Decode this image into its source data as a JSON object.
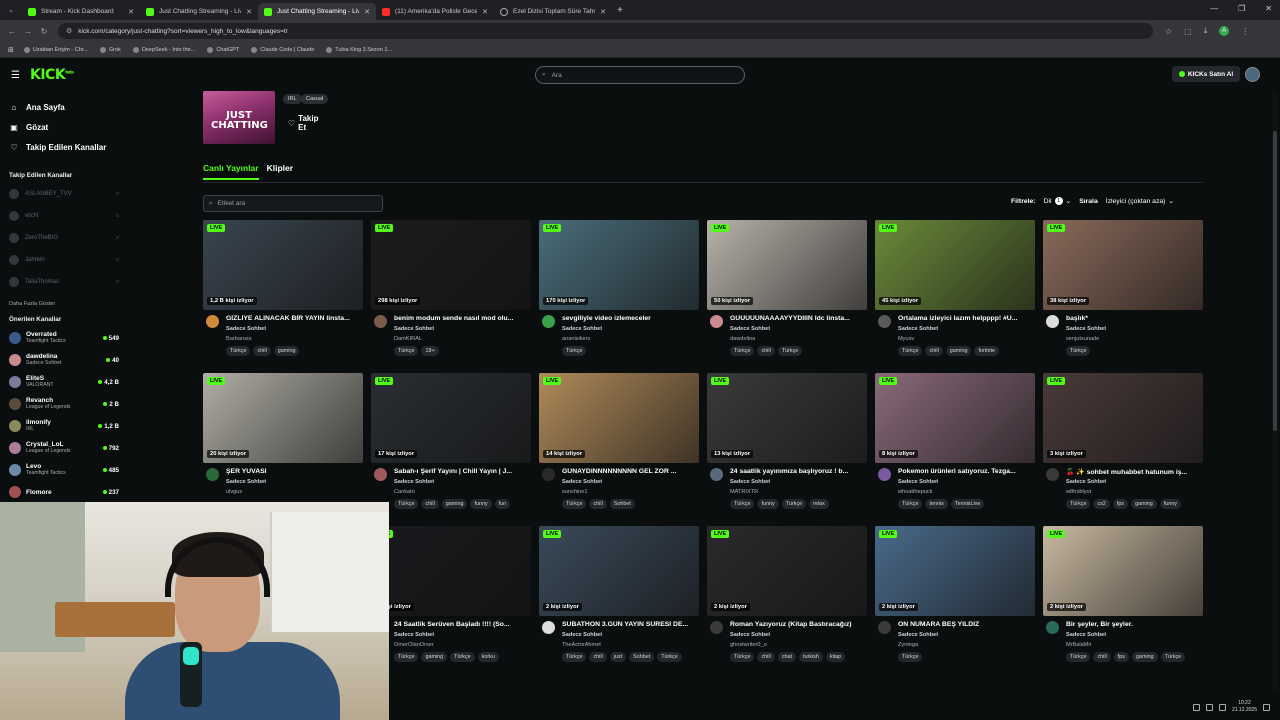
{
  "browser": {
    "tabs": [
      {
        "title": "Stream - Kick Dashboard",
        "favicon": "kick-icon",
        "active": false
      },
      {
        "title": "Just Chatting Streaming - Live",
        "favicon": "kick-icon",
        "active": false
      },
      {
        "title": "Just Chatting Streaming - Live",
        "favicon": "kick-icon",
        "active": true
      },
      {
        "title": "(11) Amerika'da Polisle Gece De...",
        "favicon": "youtube-icon",
        "active": false
      },
      {
        "title": "Ezel Dizisi Toplam Süre Tahmini",
        "favicon": "globe-icon",
        "active": false
      }
    ],
    "url": "kick.com/category/just-chatting?sort=viewers_high_to_low&languages=tr",
    "account_initial": "A",
    "bookmarks": [
      "Uzaktan Erişim - Chr...",
      "Grok",
      "DeepSeek - Into the...",
      "ChatGPT",
      "Claude Code | Claude",
      "Tulsa King 3.Sezon 1..."
    ]
  },
  "header": {
    "logo": "KICK",
    "logo_badge": "beta",
    "search_placeholder": "Ara",
    "buy_label": "KICKs Satın Al"
  },
  "sidebar": {
    "nav": [
      {
        "label": "Ana Sayfa",
        "icon": "home-icon"
      },
      {
        "label": "Gözat",
        "icon": "browse-icon"
      },
      {
        "label": "Takip Edilen Kanallar",
        "icon": "heart-icon"
      }
    ],
    "followed_heading": "Takip Edilen Kanallar",
    "followed": [
      {
        "name": "ASLANBEY_TVV"
      },
      {
        "name": "wtcN"
      },
      {
        "name": "ZeroTheBIG"
      },
      {
        "name": "Jahrein"
      },
      {
        "name": "TaliaThomas"
      }
    ],
    "more_label": "Daha Fazla Göster",
    "recommended_heading": "Önerilen Kanallar",
    "recommended": [
      {
        "name": "Overrated",
        "category": "Teamfight Tactics",
        "viewers": "549",
        "color": "#3a5a8c"
      },
      {
        "name": "dawdelina",
        "category": "Sadece Sohbet",
        "viewers": "40",
        "color": "#c98b8b"
      },
      {
        "name": "EliteS",
        "category": "VALORANT",
        "viewers": "4,2 B",
        "color": "#7a7a9a"
      },
      {
        "name": "Revanch",
        "category": "League of Legends",
        "viewers": "2 B",
        "color": "#5a4a3a"
      },
      {
        "name": "ilmonify",
        "category": "IRL",
        "viewers": "1,2 B",
        "color": "#8a8a5a"
      },
      {
        "name": "Crystal_LoL",
        "category": "League of Legends",
        "viewers": "792",
        "color": "#b07a9a"
      },
      {
        "name": "Levo",
        "category": "Teamfight Tactics",
        "viewers": "485",
        "color": "#6a8aa8"
      },
      {
        "name": "Flomore",
        "category": "",
        "viewers": "237",
        "color": "#a05050"
      }
    ]
  },
  "category": {
    "thumb_text": "JUST CHATTING",
    "tags": [
      "IRL",
      "Casual"
    ],
    "follow_label": "Takip Et",
    "tabs": [
      "Canlı Yayınlar",
      "Klipler"
    ],
    "tag_search_placeholder": "Etiket ara",
    "filter_label": "Filtrele:",
    "language_label": "Dil",
    "language_count": "1",
    "sort_label": "Sırala",
    "sort_value": "İzleyici (çoktan aza)"
  },
  "live_badge": "LIVE",
  "streams": [
    {
      "title": "GİZLİYE ALINACAK BİR YAYIN linsta...",
      "category": "Sadece Sohbet",
      "user": "Barbaross",
      "viewers": "1,2 B kişi izliyor",
      "tags": [
        "Türkçe",
        "chill",
        "gaming"
      ],
      "thumb": "#3a4550",
      "av": "#d08a3a"
    },
    {
      "title": "benim modum sende nasıl mod olu...",
      "category": "Sadece Sohbet",
      "user": "DamKIRAL",
      "viewers": "298 kişi izliyor",
      "tags": [
        "Türkçe",
        "18+"
      ],
      "thumb": "#1c1c1e",
      "av": "#7a5a4a"
    },
    {
      "title": "sevgiliyle video izlemeceler",
      "category": "Sadece Sohbet",
      "user": "ananisikers",
      "viewers": "170 kişi izliyor",
      "tags": [
        "Türkçe"
      ],
      "thumb": "#4a6d7a",
      "av": "#3aa04a"
    },
    {
      "title": "GÜÜÜÜÜNAAAAYYYDIIIN ldc linsta...",
      "category": "Sadece Sohbet",
      "user": "dawdelina",
      "viewers": "50 kişi izliyor",
      "tags": [
        "Türkçe",
        "chill",
        "Türkçe"
      ],
      "thumb": "#b8b2aa",
      "av": "#c98b8b"
    },
    {
      "title": "Ortalama izleyici lazım helpppp! #U...",
      "category": "Sadece Sohbet",
      "user": "Myusv",
      "viewers": "45 kişi izliyor",
      "tags": [
        "Türkçe",
        "chill",
        "gaming",
        "fortnite"
      ],
      "thumb": "#6a8a3a",
      "av": "#5a5a5a"
    },
    {
      "title": "başlık*",
      "category": "Sadece Sohbet",
      "user": "senjutsunade",
      "viewers": "38 kişi izliyor",
      "tags": [
        "Türkçe"
      ],
      "thumb": "#8a6a5a",
      "av": "#dddddd"
    },
    {
      "title": "ŞER YUVASI",
      "category": "Sadece Sohbet",
      "user": "ulvgus",
      "viewers": "20 kişi izliyor",
      "tags": [],
      "thumb": "#b0aea5",
      "av": "#2a6a3a"
    },
    {
      "title": "Sabah-ı Şerif Yayını | Chill Yayın | J...",
      "category": "Sadece Sohbet",
      "user": "Cankato",
      "viewers": "17 kişi izliyor",
      "tags": [
        "Türkçe",
        "chill",
        "gaming",
        "funny",
        "fun"
      ],
      "thumb": "#2a2e33",
      "av": "#a05a5a"
    },
    {
      "title": "GÜNAYDINNNNNNNNN GEL ZOR ...",
      "category": "Sadece Sohbet",
      "user": "sunshine1",
      "viewers": "14 kişi izliyor",
      "tags": [
        "Türkçe",
        "chill",
        "Sohbet"
      ],
      "thumb": "#b08a5a",
      "av": "#2a2a2a"
    },
    {
      "title": "24 saatlik yayınımıza başlıyoruz ! b...",
      "category": "Sadece Sohbet",
      "user": "MATRIXTR",
      "viewers": "13 kişi izliyor",
      "tags": [
        "Türkçe",
        "funny",
        "Türkçe",
        "relax"
      ],
      "thumb": "#3a3a3a",
      "av": "#5a6a7a"
    },
    {
      "title": "Pokemon ürünleri satıyoruz. Tezga...",
      "category": "Sadece Sohbet",
      "user": "whoatthepuck",
      "viewers": "8 kişi izliyor",
      "tags": [
        "Türkçe",
        "tennis",
        "TennisLive"
      ],
      "thumb": "#8a6a7a",
      "av": "#7a5aa0"
    },
    {
      "title": "🍒 ✨ sohbet muhabbet hatunum iş...",
      "category": "Sadece Sohbet",
      "user": "w8trsblyot",
      "viewers": "3 kişi izliyor",
      "tags": [
        "Türkçe",
        "cs2",
        "fps",
        "gaming",
        "funny"
      ],
      "thumb": "#4a3a3a",
      "av": "#3a3a3a"
    },
    {
      "title": "24 Saatlik Serüven Başladı !!!! (So...",
      "category": "Sadece Sohbet",
      "user": "OmerOlanOrser",
      "viewers": "3 kişi izliyor",
      "tags": [
        "Türkçe",
        "gaming",
        "Türkçe",
        "korku"
      ],
      "thumb": "#1a1a1e",
      "av": "#3a3a3a"
    },
    {
      "title": "SUBATHON 3.GÜN YAYIN SÜRESİ DE...",
      "category": "Sadece Sohbet",
      "user": "TheActorAhmet",
      "viewers": "2 kişi izliyor",
      "tags": [
        "Türkçe",
        "chill",
        "just",
        "Sohbet",
        "Türkçe"
      ],
      "thumb": "#3a4a5a",
      "av": "#dddddd"
    },
    {
      "title": "Roman Yazıyoruz (Kitap Bastıracağız)",
      "category": "Sadece Sohbet",
      "user": "ghostwriter0_o",
      "viewers": "2 kişi izliyor",
      "tags": [
        "Türkçe",
        "chill",
        "chat",
        "turkish",
        "kitap"
      ],
      "thumb": "#2a2a2a",
      "av": "#3a3a3a"
    },
    {
      "title": "ON NUMARA BEŞ YILDIZ",
      "category": "Sadece Sohbet",
      "user": "Zyntega",
      "viewers": "2 kişi izliyor",
      "tags": [
        "Türkçe"
      ],
      "thumb": "#4a6a8a",
      "av": "#3a3a3a"
    },
    {
      "title": "Bir şeyler, Bir şeyler.",
      "category": "Sadece Sohbet",
      "user": "MrBalaMir",
      "viewers": "2 kişi izliyor",
      "tags": [
        "Türkçe",
        "chill",
        "fps",
        "gaming",
        "Türkçe"
      ],
      "thumb": "#c8b8a0",
      "av": "#2a6a5a"
    }
  ],
  "taskbar": {
    "time": "10:22",
    "date": "21.12.2025"
  }
}
